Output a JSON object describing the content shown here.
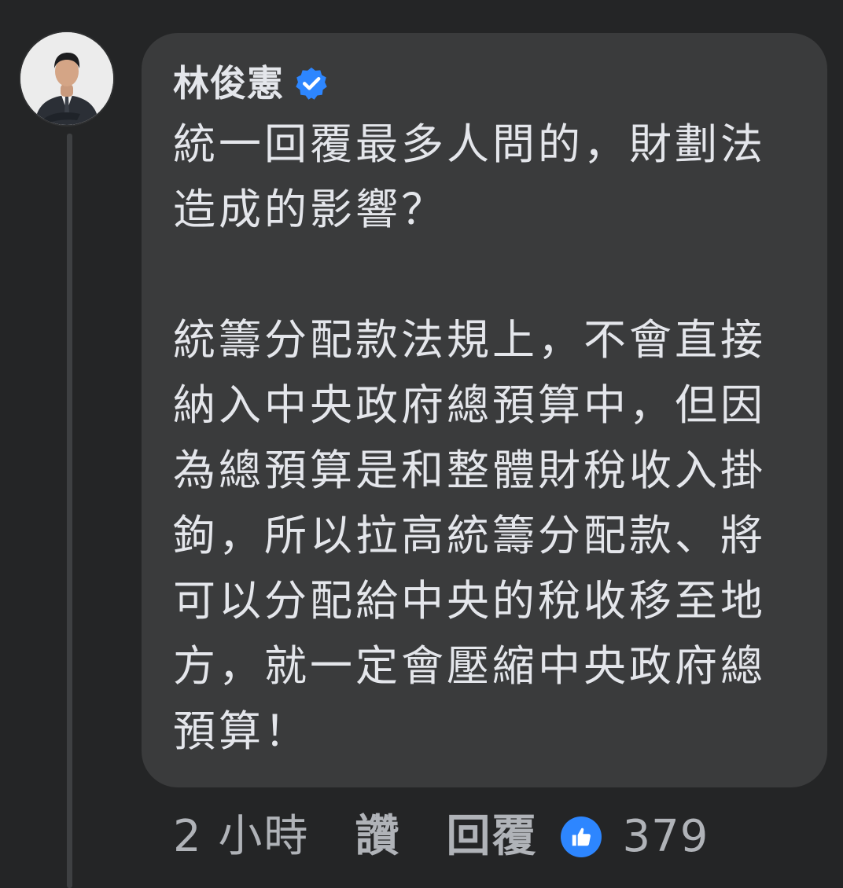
{
  "comment": {
    "author": "林俊憲",
    "verified_icon": "verified-badge-icon",
    "paragraphs": [
      [
        "統一回覆最多人問的，財劃法",
        "造成的影響？"
      ],
      [
        "統籌分配款法規上，不會直接",
        "納入中央政府總預算中，但因",
        "為總預算是和整體財稅收入掛",
        "鉤，所以拉高統籌分配款、將",
        "可以分配給中央的稅收移至地",
        "方，就一定會壓縮中央政府總",
        "預算！"
      ]
    ],
    "timestamp": "2 小時",
    "like_label": "讚",
    "reply_label": "回覆",
    "reaction_icon": "like-reaction-icon",
    "reaction_count": "379"
  },
  "colors": {
    "background": "#242526",
    "bubble": "#3a3b3c",
    "text_primary": "#e4e6eb",
    "text_secondary": "#b0b3b8",
    "accent_blue": "#2d86ff"
  }
}
